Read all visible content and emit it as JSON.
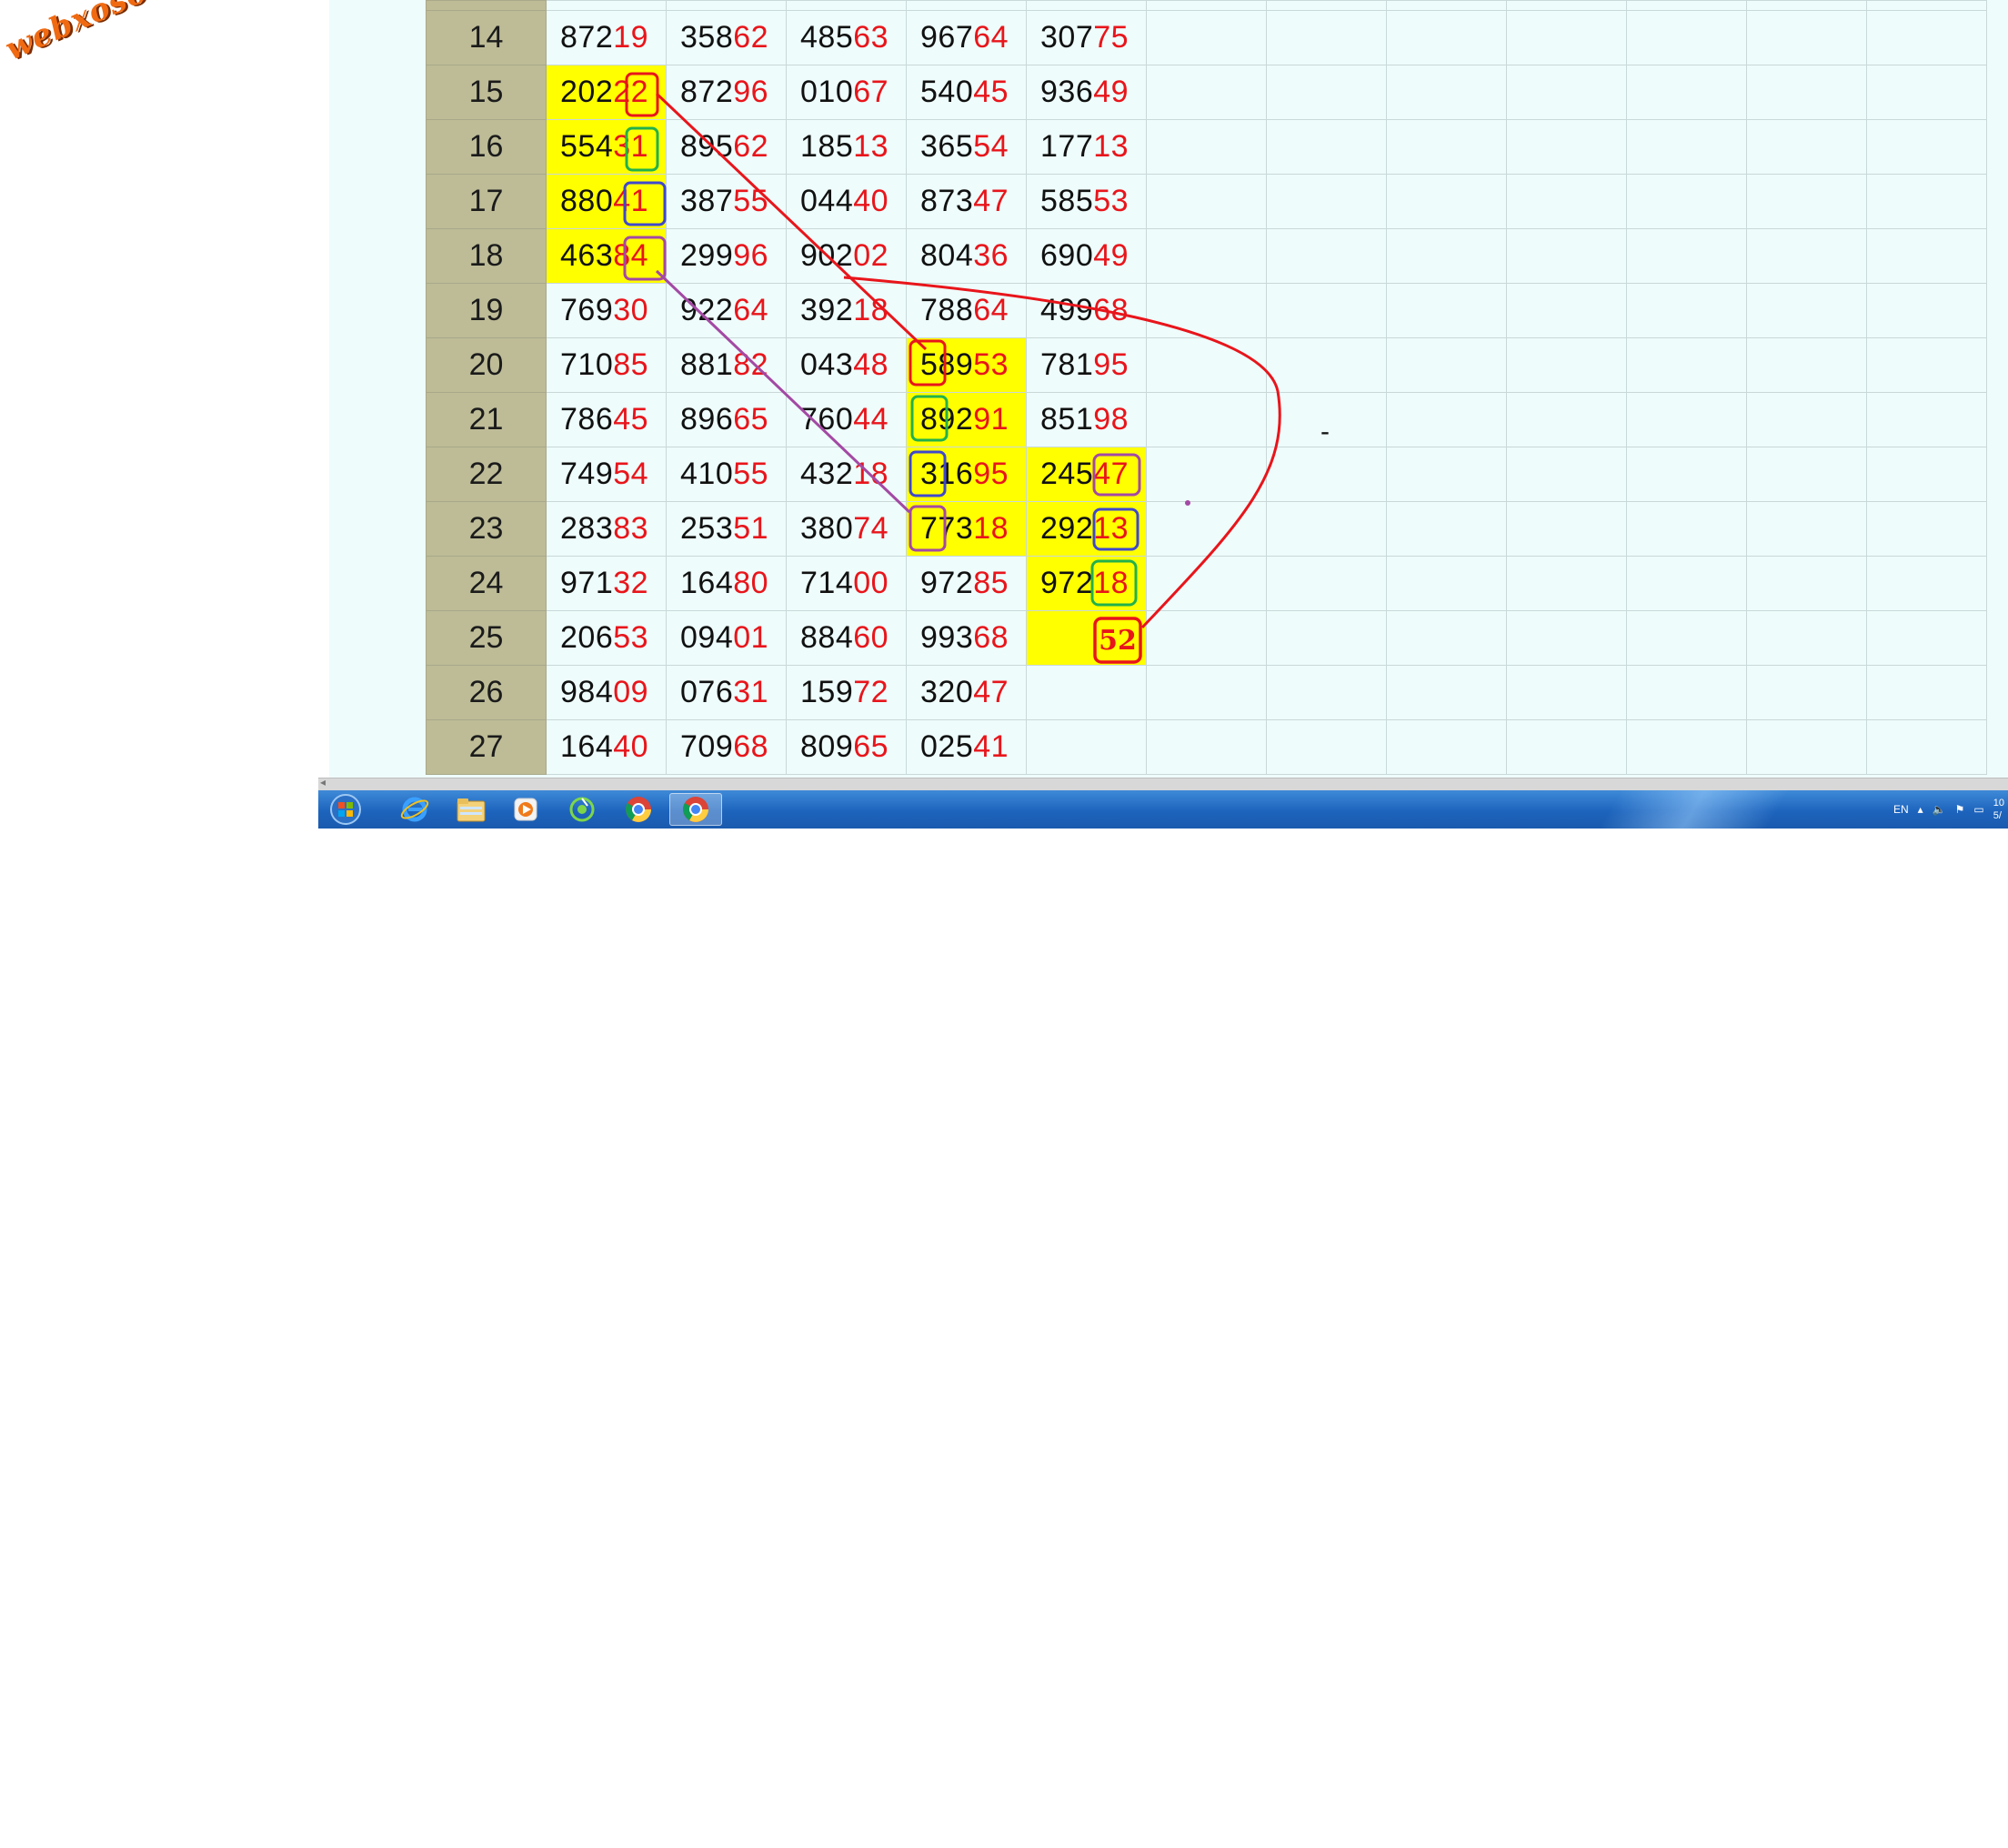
{
  "watermark": "webxoso.net",
  "grid": {
    "rows": [
      {
        "num": "14",
        "cells": [
          [
            "872",
            "19"
          ],
          [
            "358",
            "62"
          ],
          [
            "485",
            "63"
          ],
          [
            "967",
            "64"
          ],
          [
            "307",
            "75"
          ]
        ]
      },
      {
        "num": "15",
        "cells": [
          [
            "202",
            "22"
          ],
          [
            "872",
            "96"
          ],
          [
            "010",
            "67"
          ],
          [
            "540",
            "45"
          ],
          [
            "936",
            "49"
          ]
        ]
      },
      {
        "num": "16",
        "cells": [
          [
            "554",
            "31"
          ],
          [
            "895",
            "62"
          ],
          [
            "185",
            "13"
          ],
          [
            "365",
            "54"
          ],
          [
            "177",
            "13"
          ]
        ]
      },
      {
        "num": "17",
        "cells": [
          [
            "880",
            "41"
          ],
          [
            "387",
            "55"
          ],
          [
            "044",
            "40"
          ],
          [
            "873",
            "47"
          ],
          [
            "585",
            "53"
          ]
        ]
      },
      {
        "num": "18",
        "cells": [
          [
            "463",
            "84"
          ],
          [
            "299",
            "96"
          ],
          [
            "902",
            "02"
          ],
          [
            "804",
            "36"
          ],
          [
            "690",
            "49"
          ]
        ]
      },
      {
        "num": "19",
        "cells": [
          [
            "769",
            "30"
          ],
          [
            "922",
            "64"
          ],
          [
            "392",
            "18"
          ],
          [
            "788",
            "64"
          ],
          [
            "499",
            "68"
          ]
        ]
      },
      {
        "num": "20",
        "cells": [
          [
            "710",
            "85"
          ],
          [
            "881",
            "82"
          ],
          [
            "043",
            "48"
          ],
          [
            "589",
            "53"
          ],
          [
            "781",
            "95"
          ]
        ]
      },
      {
        "num": "21",
        "cells": [
          [
            "786",
            "45"
          ],
          [
            "896",
            "65"
          ],
          [
            "760",
            "44"
          ],
          [
            "892",
            "91"
          ],
          [
            "851",
            "98"
          ]
        ]
      },
      {
        "num": "22",
        "cells": [
          [
            "749",
            "54"
          ],
          [
            "410",
            "55"
          ],
          [
            "432",
            "18"
          ],
          [
            "316",
            "95"
          ],
          [
            "245",
            "47"
          ]
        ]
      },
      {
        "num": "23",
        "cells": [
          [
            "283",
            "83"
          ],
          [
            "253",
            "51"
          ],
          [
            "380",
            "74"
          ],
          [
            "773",
            "18"
          ],
          [
            "292",
            "13"
          ]
        ]
      },
      {
        "num": "24",
        "cells": [
          [
            "971",
            "32"
          ],
          [
            "164",
            "80"
          ],
          [
            "714",
            "00"
          ],
          [
            "972",
            "85"
          ],
          [
            "972",
            "18"
          ]
        ]
      },
      {
        "num": "25",
        "cells": [
          [
            "206",
            "53"
          ],
          [
            "094",
            "01"
          ],
          [
            "884",
            "60"
          ],
          [
            "993",
            "68"
          ],
          [
            "",
            ""
          ]
        ]
      },
      {
        "num": "26",
        "cells": [
          [
            "984",
            "09"
          ],
          [
            "076",
            "31"
          ],
          [
            "159",
            "72"
          ],
          [
            "320",
            "47"
          ],
          [
            "",
            ""
          ]
        ]
      },
      {
        "num": "27",
        "cells": [
          [
            "164",
            "40"
          ],
          [
            "709",
            "68"
          ],
          [
            "809",
            "65"
          ],
          [
            "025",
            "41"
          ],
          [
            "",
            ""
          ]
        ]
      }
    ],
    "highlighted": {
      "15": [
        0
      ],
      "16": [
        0
      ],
      "17": [
        0
      ],
      "18": [
        0
      ],
      "20": [
        3
      ],
      "21": [
        3
      ],
      "22": [
        3,
        4
      ],
      "23": [
        3,
        4
      ],
      "24": [
        4
      ],
      "25": [
        4
      ]
    },
    "prediction_label": "52",
    "dash": "-"
  },
  "annotation_colors": {
    "red": "#e8151b",
    "green": "#22b14c",
    "blue": "#3f48cc",
    "purple": "#a349a4",
    "highlight": "#ffff00",
    "rownum_bg": "#bdbc97"
  },
  "taskbar": {
    "buttons": [
      {
        "name": "start-orb-icon"
      },
      {
        "name": "internet-explorer-icon"
      },
      {
        "name": "file-explorer-icon"
      },
      {
        "name": "media-player-icon"
      },
      {
        "name": "app-icon"
      },
      {
        "name": "chrome-icon"
      },
      {
        "name": "chrome-icon",
        "active": true
      }
    ],
    "tray": {
      "language": "EN",
      "clock_line1": "10",
      "clock_line2": "5/"
    }
  }
}
